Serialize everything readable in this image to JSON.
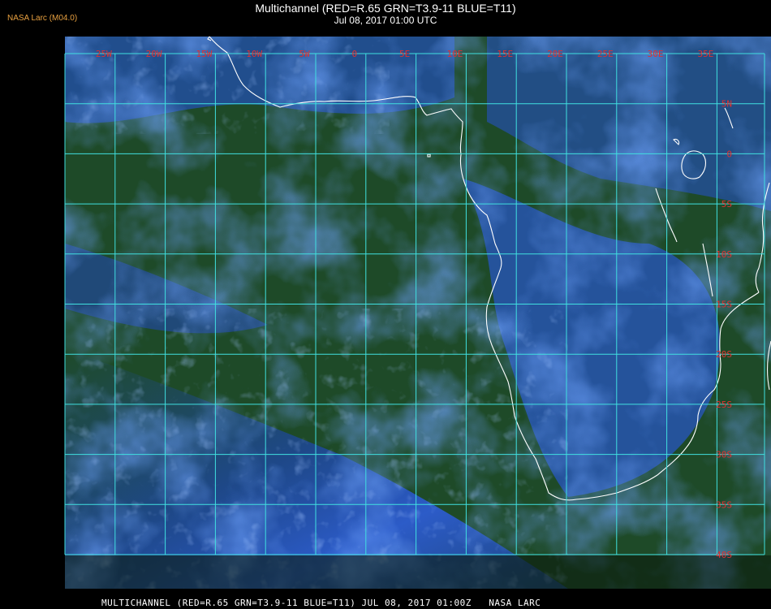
{
  "logo": "NASA Larc (M04.0)",
  "title": "Multichannel (RED=R.65 GRN=T3.9-11 BLUE=T11)",
  "subtitle": "Jul 08, 2017 01:00 UTC",
  "footer": "MULTICHANNEL (RED=R.65 GRN=T3.9-11 BLUE=T11) JUL 08, 2017 01:00Z   NASA LARC",
  "lon_labels": [
    "25W",
    "20W",
    "15W",
    "10W",
    "5W",
    "0",
    "5E",
    "10E",
    "15E",
    "20E",
    "25E",
    "30E",
    "35E"
  ],
  "lat_labels": [
    "5N",
    "0",
    "5S",
    "10S",
    "15S",
    "20S",
    "25S",
    "30S",
    "35S",
    "40S"
  ],
  "colors": {
    "grid": "#40e0e0",
    "label": "#e03030",
    "ocean": "#1e4a28",
    "cloud": "#2a5ae8",
    "coast": "#ffffff"
  }
}
